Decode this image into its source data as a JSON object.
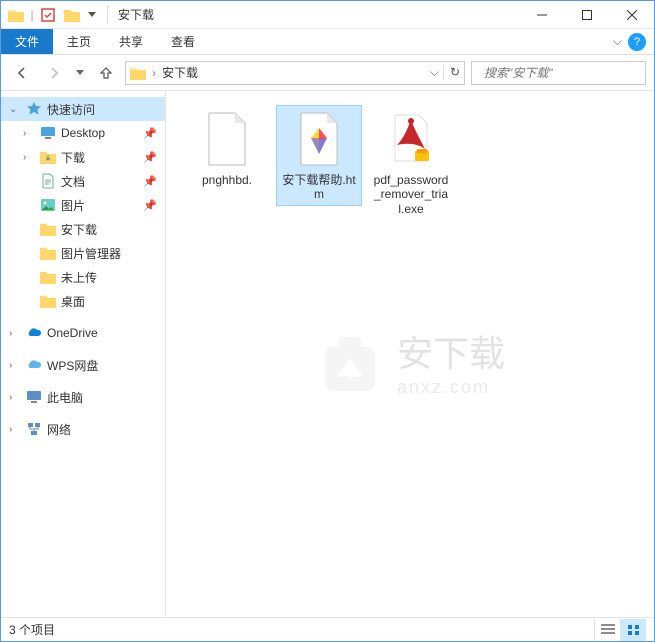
{
  "title": "安下载",
  "ribbon": {
    "file": "文件",
    "home": "主页",
    "share": "共享",
    "view": "查看"
  },
  "breadcrumb": "安下载",
  "search_placeholder": "搜索\"安下载\"",
  "sidebar": {
    "quick_access": "快速访问",
    "items": [
      {
        "label": "Desktop",
        "icon": "desktop",
        "pinned": true
      },
      {
        "label": "下载",
        "icon": "downloads",
        "pinned": true
      },
      {
        "label": "文档",
        "icon": "documents",
        "pinned": true
      },
      {
        "label": "图片",
        "icon": "pictures",
        "pinned": true
      },
      {
        "label": "安下载",
        "icon": "folder",
        "pinned": false
      },
      {
        "label": "图片管理器",
        "icon": "folder",
        "pinned": false
      },
      {
        "label": "未上传",
        "icon": "folder",
        "pinned": false
      },
      {
        "label": "桌面",
        "icon": "folder",
        "pinned": false
      }
    ],
    "onedrive": "OneDrive",
    "wps": "WPS网盘",
    "this_pc": "此电脑",
    "network": "网络"
  },
  "files": [
    {
      "name": "pnghhbd.",
      "type": "blank"
    },
    {
      "name": "安下载帮助.htm",
      "type": "htm",
      "selected": true
    },
    {
      "name": "pdf_password_remover_trial.exe",
      "type": "pdf_exe"
    }
  ],
  "status": "3 个项目",
  "watermark": {
    "main": "安下载",
    "sub": "anxz.com"
  }
}
